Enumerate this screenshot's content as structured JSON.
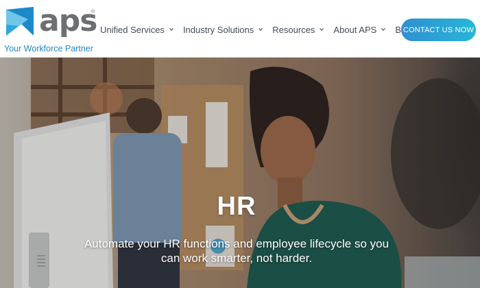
{
  "brand": {
    "name": "aps",
    "registered_mark": "®",
    "tagline": "Your Workforce Partner",
    "colors": {
      "wordmark": "#6d6f71",
      "tagline": "#1e88c8",
      "mark_light": "#6ec6e8",
      "mark_dark": "#1c8ac9"
    }
  },
  "nav": {
    "items": [
      {
        "label": "Unified Services",
        "has_dropdown": true
      },
      {
        "label": "Industry Solutions",
        "has_dropdown": true
      },
      {
        "label": "Resources",
        "has_dropdown": true
      },
      {
        "label": "About APS",
        "has_dropdown": true
      },
      {
        "label": "Blog",
        "has_dropdown": false
      }
    ],
    "chevron_icon": "chevron-down-icon"
  },
  "cta": {
    "label": "CONTACT US NOW",
    "colors": {
      "start": "#2f8fd1",
      "end": "#27b6d8"
    }
  },
  "hero": {
    "title": "HR",
    "subtitle": "Automate your HR functions and employee lifecycle so you can work smarter, not harder."
  }
}
